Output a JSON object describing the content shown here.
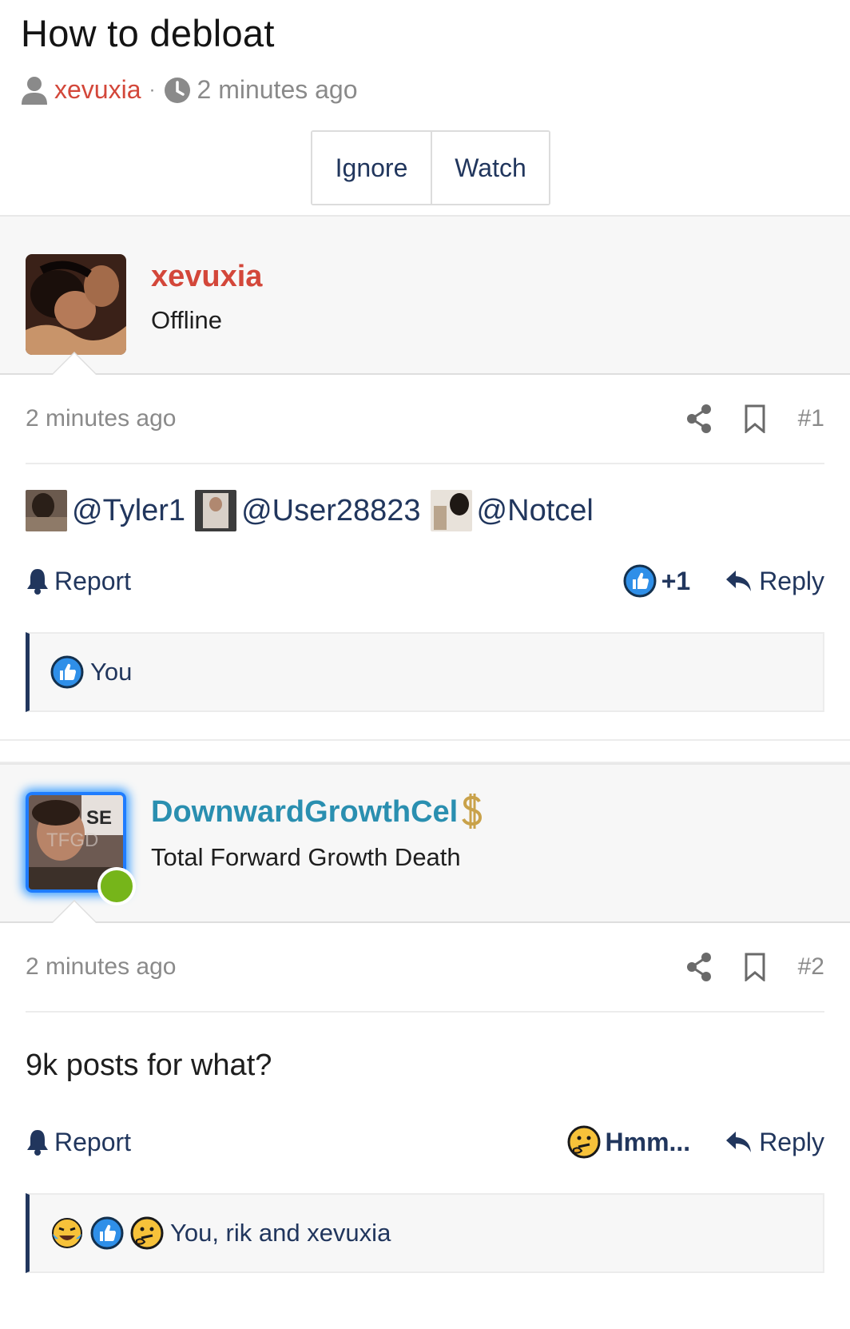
{
  "thread": {
    "title": "How to debloat",
    "author": "xevuxia",
    "separator": "·",
    "time": "2 minutes ago",
    "ignore_label": "Ignore",
    "watch_label": "Watch"
  },
  "posts": [
    {
      "user": {
        "name": "xevuxia",
        "title": "Offline",
        "name_color": "#d3473a"
      },
      "time": "2 minutes ago",
      "number": "#1",
      "mentions": [
        "@Tyler1",
        "@User28823",
        "@Notcel"
      ],
      "report_label": "Report",
      "reaction_label": "+1",
      "reaction_icon": "like-icon",
      "reply_label": "Reply",
      "reactions_summary": "You",
      "reactions_icons": [
        "like-icon"
      ]
    },
    {
      "user": {
        "name": "DownwardGrowthCel",
        "title": "Total Forward Growth Death",
        "name_color": "#2a8fb0",
        "online": true
      },
      "time": "2 minutes ago",
      "number": "#2",
      "body": "9k posts for what?",
      "report_label": "Report",
      "reaction_label": "Hmm...",
      "reaction_icon": "thinking-icon",
      "reply_label": "Reply",
      "reactions_summary": "You, rik and xevuxia",
      "reactions_icons": [
        "laughing-crying-icon",
        "like-icon",
        "thinking-icon"
      ]
    }
  ],
  "colors": {
    "accent": "#21365d",
    "author_red": "#d3473a",
    "online_green": "#76b51a",
    "muted": "#8a8a8a"
  }
}
